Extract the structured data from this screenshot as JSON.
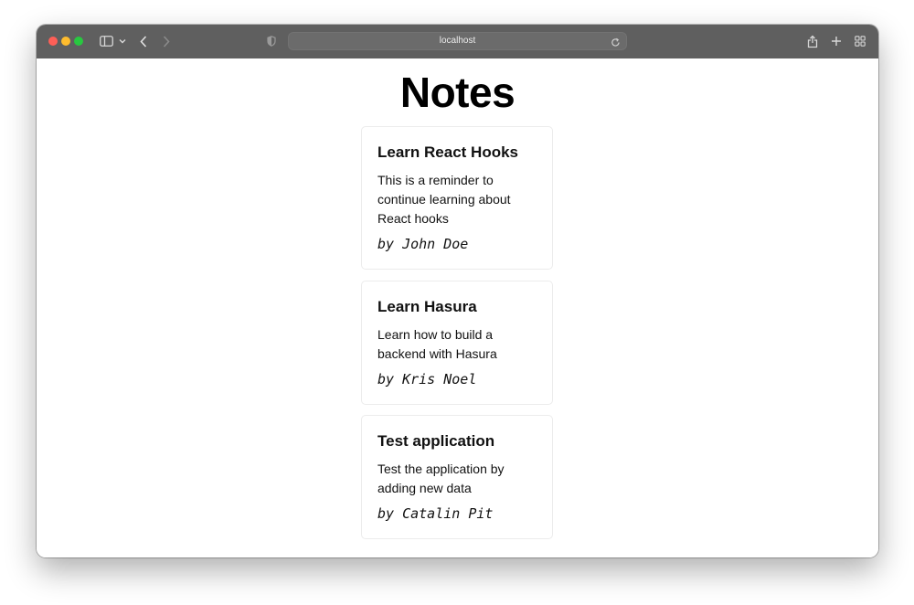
{
  "browser": {
    "address": "localhost"
  },
  "page": {
    "title": "Notes"
  },
  "notes": [
    {
      "title": "Learn React Hooks",
      "body": "This is a reminder to continue learning about React hooks",
      "author": "by John Doe"
    },
    {
      "title": "Learn Hasura",
      "body": "Learn how to build a backend with Hasura",
      "author": "by Kris Noel"
    },
    {
      "title": "Test application",
      "body": "Test the application by adding new data",
      "author": "by Catalin Pit"
    }
  ]
}
